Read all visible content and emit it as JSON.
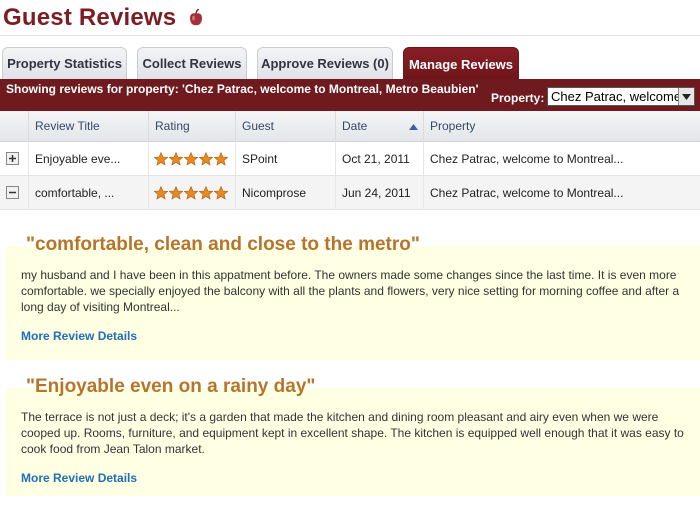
{
  "header": {
    "title": "Guest Reviews",
    "help_icon": "apple-help-icon"
  },
  "tabs": [
    {
      "label": "Property Statistics"
    },
    {
      "label": "Collect Reviews"
    },
    {
      "label": "Approve Reviews (0)"
    },
    {
      "label": "Manage Reviews"
    }
  ],
  "banner": {
    "text": "Showing reviews for property: 'Chez Patrac, welcome to Montreal, Metro Beaubien'",
    "property_label": "Property:",
    "property_value": "Chez Patrac, welcome to Montreal, Metro Beaubien"
  },
  "table": {
    "columns": [
      "Review Title",
      "Rating",
      "Guest",
      "Date",
      "Property"
    ],
    "sort_icon": "sort-ascending-icon",
    "rows": [
      {
        "toggle": "expand",
        "title": "Enjoyable eve...",
        "rating": 5,
        "guest": "SPoint",
        "date": "Oct 21, 2011",
        "property": "Chez Patrac, welcome to Montreal..."
      },
      {
        "toggle": "collapse",
        "title": "comfortable, ...",
        "rating": 5,
        "guest": "Nicomprose",
        "date": "Jun 24, 2011",
        "property": "Chez Patrac, welcome to Montreal..."
      }
    ]
  },
  "reviews": [
    {
      "title": "\"comfortable, clean and close to the metro\"",
      "body": "my husband and I have been in this appatment before. The owners made some changes since the last time. It is even more comfortable. we specially enjoyed the balcony with all the plants and flowers, very nice setting for morning coffee and after a long day of visiting Montreal...",
      "link": "More Review Details"
    },
    {
      "title": "\"Enjoyable even on a rainy day\"",
      "body": "The terrace is not just a deck; it's a garden that made the kitchen and dining room pleasant and airy even when we were cooped up. Rooms, furniture, and equipment kept in excellent shape. The kitchen is equipped well enough that it was easy to cook food from Jean Talon market.",
      "link": "More Review Details"
    }
  ],
  "colors": {
    "brand": "#7a1e23",
    "banner": "#6f1a1e",
    "review_bg": "#ffffe4",
    "review_title": "#b7752a",
    "link": "#1e6fb8",
    "star": "#e48a1f"
  }
}
